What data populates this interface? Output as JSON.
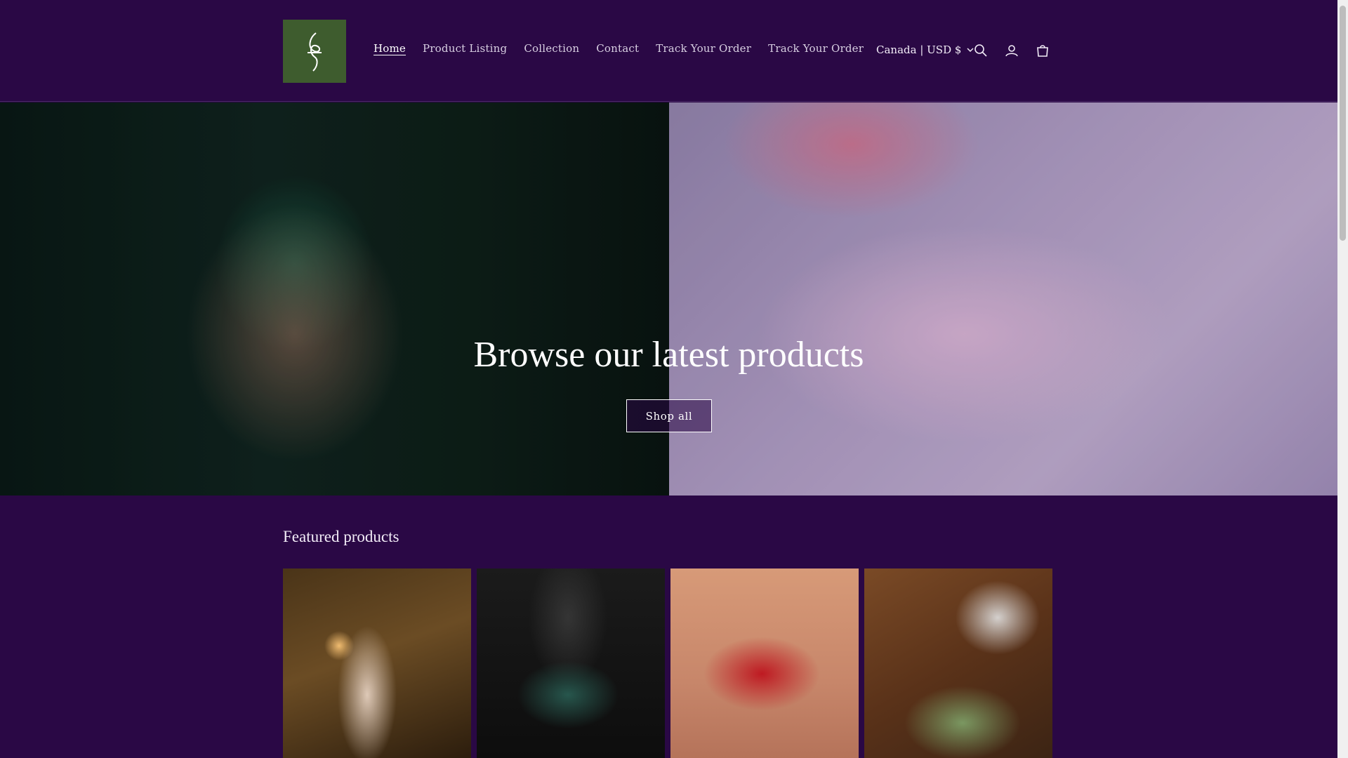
{
  "header": {
    "logo_alt": "store logo",
    "nav": [
      {
        "label": "Home",
        "active": true
      },
      {
        "label": "Product Listing",
        "active": false
      },
      {
        "label": "Collection",
        "active": false
      },
      {
        "label": "Contact",
        "active": false
      },
      {
        "label": "Track Your Order",
        "active": false
      },
      {
        "label": "Track Your Order",
        "active": false
      }
    ],
    "locale": "Canada | USD $",
    "icons": [
      "search-icon",
      "account-icon",
      "cart-icon"
    ]
  },
  "hero": {
    "title": "Browse our latest products",
    "button_label": "Shop all"
  },
  "featured": {
    "title": "Featured products",
    "products": [
      {
        "image": "product-image-1"
      },
      {
        "image": "product-image-2"
      },
      {
        "image": "product-image-3"
      },
      {
        "image": "product-image-4"
      }
    ]
  },
  "colors": {
    "background": "#2a0845",
    "logo_bg": "#3e5c2e",
    "text": "#f2ecf7"
  }
}
